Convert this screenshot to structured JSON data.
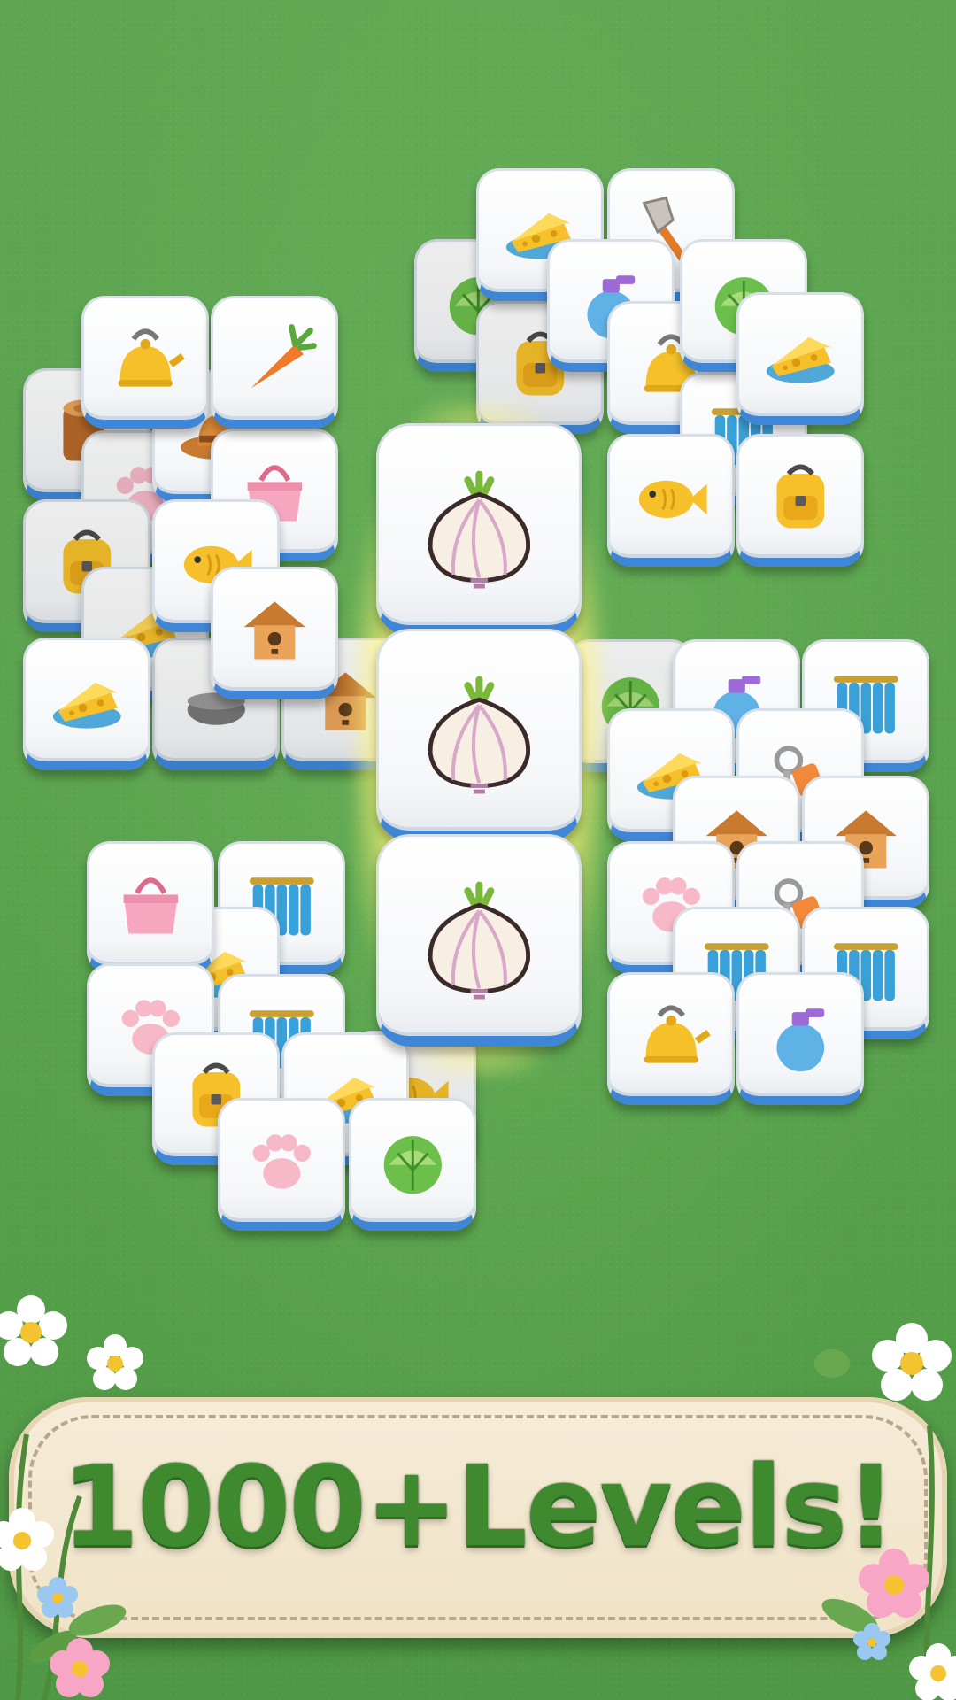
{
  "banner": {
    "title": "1000+Levels!"
  },
  "colors": {
    "felt_green": "#5aa34e",
    "tile_face": "#ffffff",
    "tile_edge_blue": "#3f86d6",
    "highlight_glow": "#fff38a",
    "banner_cream": "#f3e7cf",
    "text_green": "#3f8a2f"
  },
  "selected_stack": {
    "icon": "garlic-icon",
    "count": 3
  },
  "tiles": [
    {
      "icon": "cabbage-icon",
      "layer": 0
    },
    {
      "icon": "cheese-icon",
      "layer": 1
    },
    {
      "icon": "shovel-icon",
      "layer": 1
    },
    {
      "icon": "backpack-icon",
      "layer": 0
    },
    {
      "icon": "spray-bottle-icon",
      "layer": 1
    },
    {
      "icon": "cabbage-icon",
      "layer": 2
    },
    {
      "icon": "kettle-icon",
      "layer": 1
    },
    {
      "icon": "cheese-icon",
      "layer": 2
    },
    {
      "icon": "curtain-icon",
      "layer": 1
    },
    {
      "icon": "fish-icon",
      "layer": 1
    },
    {
      "icon": "backpack-icon",
      "layer": 2
    },
    {
      "icon": "log-icon",
      "layer": 0
    },
    {
      "icon": "kettle-icon",
      "layer": 2
    },
    {
      "icon": "carrot-icon",
      "layer": 2
    },
    {
      "icon": "hat-icon",
      "layer": 1
    },
    {
      "icon": "paw-icon",
      "layer": 0
    },
    {
      "icon": "handbag-icon",
      "layer": 1
    },
    {
      "icon": "backpack-icon",
      "layer": 0
    },
    {
      "icon": "fish-icon",
      "layer": 1
    },
    {
      "icon": "cheese-icon",
      "layer": 0
    },
    {
      "icon": "birdhouse-icon",
      "layer": 1
    },
    {
      "icon": "cheese-icon",
      "layer": 1
    },
    {
      "icon": "pot-icon",
      "layer": 0
    },
    {
      "icon": "birdhouse-icon",
      "layer": 0
    },
    {
      "icon": "cabbage-icon",
      "layer": 0
    },
    {
      "icon": "spray-bottle-icon",
      "layer": 1
    },
    {
      "icon": "curtain-icon",
      "layer": 1
    },
    {
      "icon": "cheese-icon",
      "layer": 1
    },
    {
      "icon": "keys-icon",
      "layer": 1
    },
    {
      "icon": "birdhouse-icon",
      "layer": 2
    },
    {
      "icon": "birdhouse-icon",
      "layer": 2
    },
    {
      "icon": "paw-icon",
      "layer": 2
    },
    {
      "icon": "keys-icon",
      "layer": 2
    },
    {
      "icon": "curtain-icon",
      "layer": 3
    },
    {
      "icon": "curtain-icon",
      "layer": 3
    },
    {
      "icon": "kettle-icon",
      "layer": 4
    },
    {
      "icon": "spray-bottle-icon",
      "layer": 4
    },
    {
      "icon": "handbag-icon",
      "layer": 2
    },
    {
      "icon": "curtain-icon",
      "layer": 1
    },
    {
      "icon": "cheese-icon",
      "layer": 1
    },
    {
      "icon": "paw-icon",
      "layer": 2
    },
    {
      "icon": "curtain-icon",
      "layer": 1
    },
    {
      "icon": "backpack-icon",
      "layer": 2
    },
    {
      "icon": "cheese-icon",
      "layer": 1
    },
    {
      "icon": "fish-icon",
      "layer": 0
    },
    {
      "icon": "paw-icon",
      "layer": 2
    },
    {
      "icon": "cabbage-icon",
      "layer": 2
    }
  ]
}
